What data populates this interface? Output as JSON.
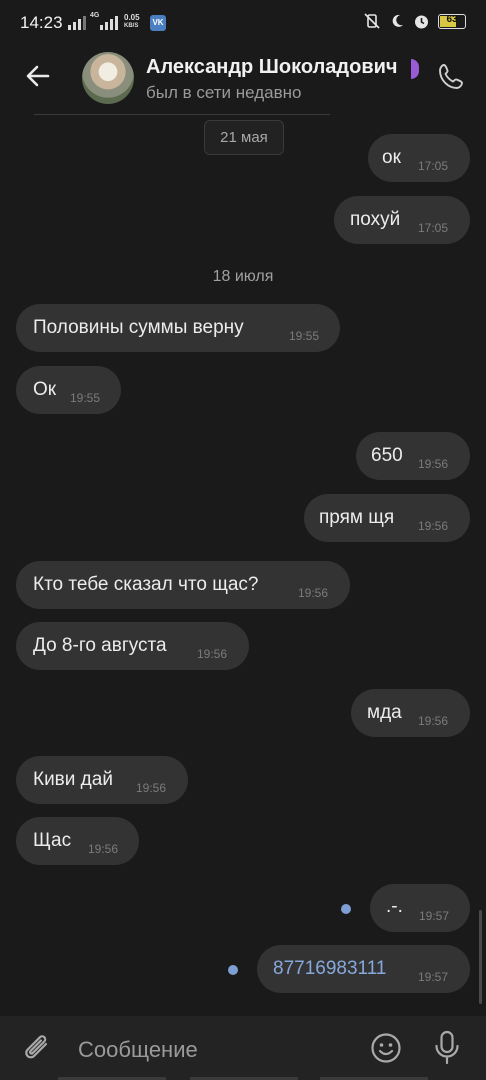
{
  "status_bar": {
    "time": "14:23",
    "net_speed": "0.05",
    "net_unit": "KB/S",
    "network_type": "4G",
    "battery": "63",
    "vk_icon": "VK"
  },
  "header": {
    "contact_name": "Александр Шоколадович",
    "presence": "был в сети недавно",
    "back_icon": "arrow-left-icon",
    "call_icon": "phone-icon"
  },
  "messages": [
    {
      "type": "date",
      "text": "21 мая"
    },
    {
      "type": "out",
      "text": "ок",
      "time": "17:05"
    },
    {
      "type": "out",
      "text": "похуй",
      "time": "17:05"
    },
    {
      "type": "date",
      "text": "18 июля"
    },
    {
      "type": "in",
      "text": "Половины суммы верну",
      "time": "19:55"
    },
    {
      "type": "in",
      "text": "Ок",
      "time": "19:55"
    },
    {
      "type": "out",
      "text": "650",
      "time": "19:56"
    },
    {
      "type": "out",
      "text": "прям щя",
      "time": "19:56"
    },
    {
      "type": "in",
      "text": "Кто тебе сказал что щас?",
      "time": "19:56"
    },
    {
      "type": "in",
      "text": "До 8-го августа",
      "time": "19:56"
    },
    {
      "type": "out",
      "text": "мда",
      "time": "19:56"
    },
    {
      "type": "in",
      "text": "Киви дай",
      "time": "19:56"
    },
    {
      "type": "in",
      "text": "Щас",
      "time": "19:56"
    },
    {
      "type": "out",
      "text": ".-.",
      "time": "19:57",
      "unread": true
    },
    {
      "type": "out",
      "text": "87716983111",
      "time": "19:57",
      "unread": true,
      "link": true
    }
  ],
  "composer": {
    "placeholder": "Сообщение",
    "attach_icon": "paperclip-icon",
    "emoji_icon": "smiley-icon",
    "mic_icon": "microphone-icon"
  },
  "colors": {
    "background": "#1a1a1a",
    "bubble": "#333333",
    "accent": "#7d9fd3",
    "link": "#86a9dc"
  }
}
